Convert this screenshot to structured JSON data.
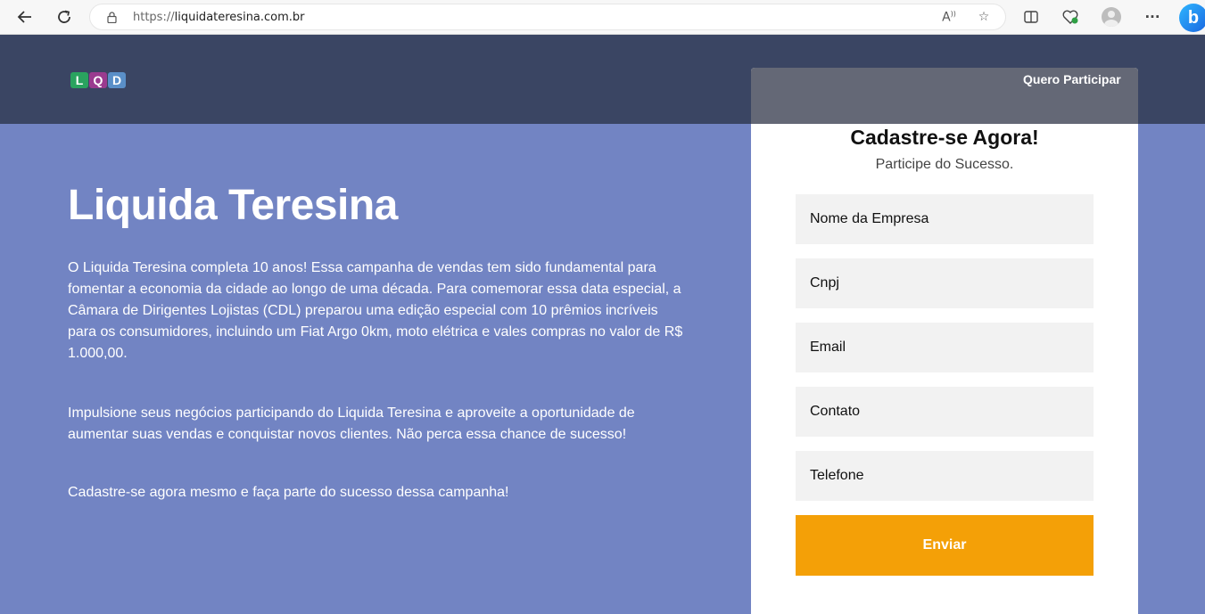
{
  "browser": {
    "url_proto": "https://",
    "url_host": "liquidateresina.com.br",
    "icons": [
      "back-icon",
      "refresh-icon",
      "lock-icon",
      "read-aloud-icon",
      "favorite-icon",
      "split-screen-icon",
      "browser-health-icon",
      "profile-avatar-icon",
      "more-icon",
      "bing-copilot-icon"
    ]
  },
  "header": {
    "logo_letters": [
      "L",
      "Q",
      "D"
    ],
    "logo_colors": [
      "#2aa35f",
      "#9a3b8f",
      "#5a8fc8"
    ],
    "cta": "Quero Participar"
  },
  "hero": {
    "title": "Liquida Teresina",
    "p1": "O Liquida Teresina completa 10 anos! Essa campanha de vendas tem sido fundamental para fomentar a economia da cidade ao longo de uma década. Para comemorar essa data especial, a Câmara de Dirigentes Lojistas (CDL) preparou uma edição especial com 10 prêmios incríveis para os consumidores, incluindo um Fiat Argo 0km, moto elétrica e vales compras no valor de R$ 1.000,00.",
    "p2": "Impulsione seus negócios participando do Liquida Teresina e aproveite a oportunidade de aumentar suas vendas e conquistar novos clientes. Não perca essa chance de sucesso!",
    "p3": "Cadastre-se agora mesmo e faça parte do sucesso dessa campanha!"
  },
  "form": {
    "title": "Cadastre-se Agora!",
    "subtitle": "Participe do Sucesso.",
    "fields": [
      {
        "placeholder": "Nome da Empresa"
      },
      {
        "placeholder": "Cnpj"
      },
      {
        "placeholder": "Email"
      },
      {
        "placeholder": "Contato"
      },
      {
        "placeholder": "Telefone"
      }
    ],
    "submit": "Enviar"
  },
  "colors": {
    "page_bg": "#7284c3",
    "header_bg": "#3a4563",
    "button": "#f4a007"
  }
}
